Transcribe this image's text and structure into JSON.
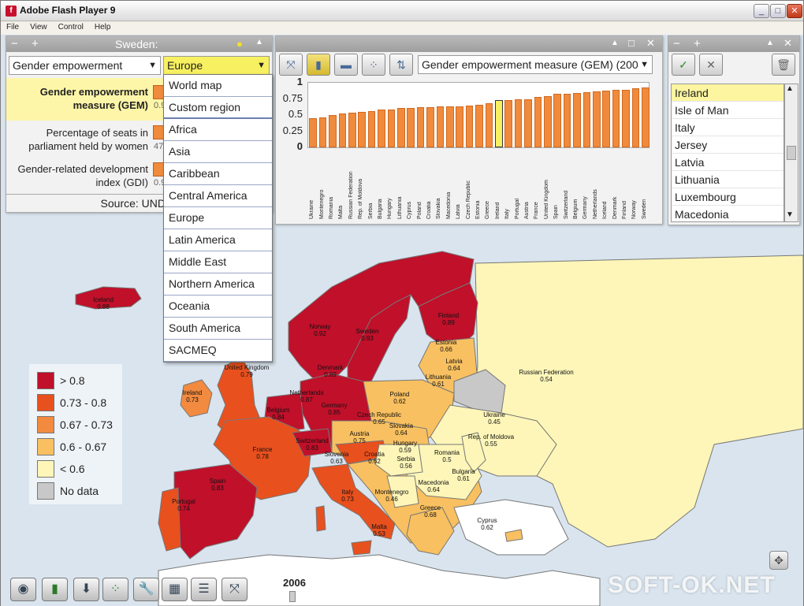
{
  "window": {
    "title": "Adobe Flash Player 9"
  },
  "menu": [
    "File",
    "View",
    "Control",
    "Help"
  ],
  "left_panel": {
    "title": "Sweden:",
    "indicator_select": "Gender empowerment",
    "region_select": "Europe",
    "rows": [
      {
        "label": "Gender empowerment measure (GEM)",
        "value": "0.9"
      },
      {
        "label": "Percentage of seats in parliament held by women",
        "value": "47"
      },
      {
        "label": "Gender-related development index (GDI)",
        "value": "0.9"
      }
    ],
    "source": "Source: UND"
  },
  "region_menu": {
    "top": [
      "World map",
      "Custom region"
    ],
    "regions": [
      "Africa",
      "Asia",
      "Caribbean",
      "Central America",
      "Europe",
      "Latin America",
      "Middle East",
      "Northern America",
      "Oceania",
      "South America",
      "SACMEQ"
    ]
  },
  "chart_panel": {
    "indicator_select": "Gender empowerment measure (GEM) (200"
  },
  "chart_data": {
    "type": "bar",
    "categories": [
      "Ukraine",
      "Montenegro",
      "Romania",
      "Malta",
      "Russian Federation",
      "Rep. of Moldova",
      "Serbia",
      "Bulgaria",
      "Hungary",
      "Lithuania",
      "Cyprus",
      "Poland",
      "Croatia",
      "Slovakia",
      "Macedonia",
      "Latvia",
      "Czech Republic",
      "Estonia",
      "Greece",
      "Ireland",
      "Italy",
      "Portugal",
      "Austria",
      "France",
      "United Kingdom",
      "Spain",
      "Switzerland",
      "Belgium",
      "Germany",
      "Netherlands",
      "Iceland",
      "Denmark",
      "Finland",
      "Norway",
      "Sweden"
    ],
    "values": [
      0.45,
      0.46,
      0.5,
      0.53,
      0.54,
      0.55,
      0.56,
      0.58,
      0.59,
      0.61,
      0.61,
      0.62,
      0.62,
      0.64,
      0.64,
      0.64,
      0.65,
      0.66,
      0.68,
      0.73,
      0.73,
      0.74,
      0.75,
      0.78,
      0.79,
      0.83,
      0.83,
      0.84,
      0.85,
      0.87,
      0.88,
      0.89,
      0.89,
      0.92,
      0.93
    ],
    "highlight": "Ireland",
    "yticks": [
      "1",
      "0.75",
      "0.5",
      "0.25",
      "0"
    ],
    "ylim": [
      0,
      1
    ],
    "bar_color": "#f08a3c",
    "highlight_color": "#f7f060"
  },
  "country_list": {
    "items": [
      "Ireland",
      "Isle of Man",
      "Italy",
      "Jersey",
      "Latvia",
      "Lithuania",
      "Luxembourg",
      "Macedonia"
    ],
    "selected": "Ireland"
  },
  "legend": [
    {
      "label": "> 0.8",
      "color": "#c0102a"
    },
    {
      "label": "0.73 - 0.8",
      "color": "#e8501e"
    },
    {
      "label": "0.67 - 0.73",
      "color": "#f28a40"
    },
    {
      "label": "0.6 - 0.67",
      "color": "#f8c060"
    },
    {
      "label": "< 0.6",
      "color": "#fdf6b8"
    },
    {
      "label": "No data",
      "color": "#c8c8c8"
    }
  ],
  "map_labels": [
    {
      "name": "Iceland",
      "value": "0.88"
    },
    {
      "name": "Norway",
      "value": "0.92"
    },
    {
      "name": "Sweden",
      "value": "0.93"
    },
    {
      "name": "Finland",
      "value": "0.89"
    },
    {
      "name": "Estonia",
      "value": "0.66"
    },
    {
      "name": "Latvia",
      "value": "0.64"
    },
    {
      "name": "Lithuania",
      "value": "0.61"
    },
    {
      "name": "Denmark",
      "value": "0.89"
    },
    {
      "name": "United Kingdom",
      "value": "0.79"
    },
    {
      "name": "Ireland",
      "value": "0.73"
    },
    {
      "name": "Netherlands",
      "value": "0.87"
    },
    {
      "name": "Belgium",
      "value": "0.84"
    },
    {
      "name": "Germany",
      "value": "0.85"
    },
    {
      "name": "Poland",
      "value": "0.62"
    },
    {
      "name": "Czech Republic",
      "value": "0.65"
    },
    {
      "name": "Slovakia",
      "value": "0.64"
    },
    {
      "name": "Ukraine",
      "value": "0.45"
    },
    {
      "name": "Rep. of Moldova",
      "value": "0.55"
    },
    {
      "name": "Russian Federation",
      "value": "0.54"
    },
    {
      "name": "France",
      "value": "0.78"
    },
    {
      "name": "Switzerland",
      "value": "0.83"
    },
    {
      "name": "Austria",
      "value": "0.75"
    },
    {
      "name": "Hungary",
      "value": "0.59"
    },
    {
      "name": "Slovenia",
      "value": "0.63"
    },
    {
      "name": "Croatia",
      "value": "0.62"
    },
    {
      "name": "Serbia",
      "value": "0.56"
    },
    {
      "name": "Romania",
      "value": "0.5"
    },
    {
      "name": "Bulgaria",
      "value": "0.61"
    },
    {
      "name": "Macedonia",
      "value": "0.64"
    },
    {
      "name": "Montenegro",
      "value": "0.46"
    },
    {
      "name": "Greece",
      "value": "0.68"
    },
    {
      "name": "Italy",
      "value": "0.73"
    },
    {
      "name": "Spain",
      "value": "0.83"
    },
    {
      "name": "Portugal",
      "value": "0.74"
    },
    {
      "name": "Malta",
      "value": "0.53"
    },
    {
      "name": "Cyprus",
      "value": "0.62"
    }
  ],
  "timeline": {
    "year": "2006"
  },
  "watermark": "SOFT-OK.NET"
}
